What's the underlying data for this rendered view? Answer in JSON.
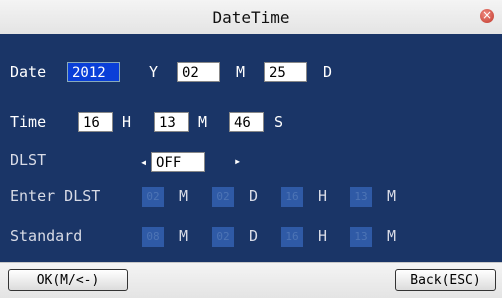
{
  "window": {
    "title": "DateTime",
    "close_glyph": "×"
  },
  "date": {
    "label": "Date",
    "year": "2012",
    "year_unit": "Y",
    "month": "02",
    "month_unit": "M",
    "day": "25",
    "day_unit": "D"
  },
  "time": {
    "label": "Time",
    "hour": "16",
    "hour_unit": "H",
    "minute": "13",
    "minute_unit": "M",
    "second": "46",
    "second_unit": "S"
  },
  "dlst": {
    "label": "DLST",
    "value": "OFF",
    "left_arrow": "◂",
    "right_arrow": "▸"
  },
  "enter_dlst": {
    "label": "Enter DLST",
    "fields": [
      "02",
      "02",
      "16",
      "13"
    ],
    "units": [
      "M",
      "D",
      "H",
      "M"
    ]
  },
  "standard": {
    "label": "Standard",
    "fields": [
      "08",
      "02",
      "16",
      "13"
    ],
    "units": [
      "M",
      "D",
      "H",
      "M"
    ]
  },
  "buttons": {
    "ok": "OK(M/<-)",
    "back": "Back(ESC)"
  },
  "colors": {
    "panel": "#1a3567",
    "selected": "#0a3fd8",
    "disabled_field": "#2f5aa6"
  }
}
